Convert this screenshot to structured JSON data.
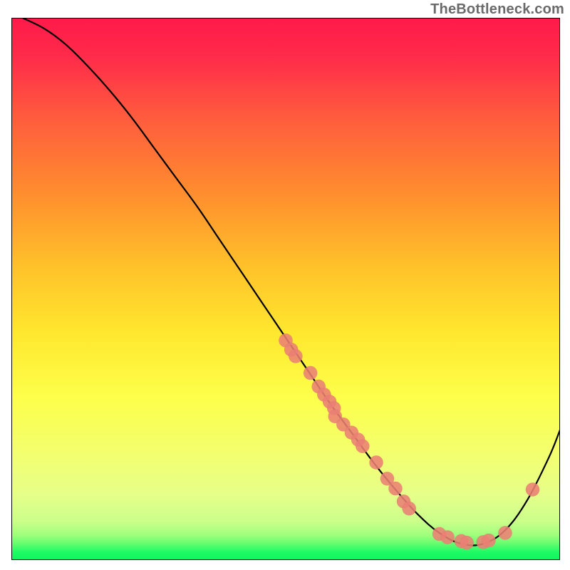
{
  "watermark": {
    "text": "TheBottleneck.com"
  },
  "colors": {
    "gradient_top": "#ff1a4a",
    "gradient_mid_upper": "#ff8c2e",
    "gradient_mid": "#ffe72e",
    "gradient_lower": "#e9ff6b",
    "gradient_green": "#1ffb65",
    "curve_stroke": "#000000",
    "marker_fill": "#eb8074",
    "axis_stroke": "#000000",
    "background": "#ffffff"
  },
  "chart_data": {
    "type": "line",
    "title": "",
    "xlabel": "",
    "ylabel": "",
    "xlim": [
      0,
      100
    ],
    "ylim": [
      0,
      100
    ],
    "curve": {
      "x": [
        2,
        6,
        10,
        14,
        18,
        22,
        26,
        30,
        34,
        38,
        42,
        46,
        50,
        54,
        58,
        62,
        66,
        70,
        74,
        78,
        82,
        86,
        90,
        94,
        98,
        100
      ],
      "y": [
        100,
        98,
        95,
        91,
        86.5,
        81.5,
        76,
        70.5,
        65,
        59,
        53,
        47,
        41,
        35,
        29,
        23.5,
        18,
        13,
        8.5,
        5,
        3,
        3,
        5.5,
        11,
        19,
        24
      ]
    },
    "markers": [
      {
        "x": 50.0,
        "y": 40.5,
        "r": 1.4
      },
      {
        "x": 51.0,
        "y": 38.8,
        "r": 1.4
      },
      {
        "x": 51.8,
        "y": 37.6,
        "r": 1.4
      },
      {
        "x": 54.5,
        "y": 34.5,
        "r": 1.4
      },
      {
        "x": 56.0,
        "y": 32.0,
        "r": 1.4
      },
      {
        "x": 57.0,
        "y": 30.5,
        "r": 1.4
      },
      {
        "x": 58.0,
        "y": 29.2,
        "r": 1.4
      },
      {
        "x": 58.8,
        "y": 28.0,
        "r": 1.4
      },
      {
        "x": 59.0,
        "y": 26.5,
        "r": 1.4
      },
      {
        "x": 60.5,
        "y": 25.0,
        "r": 1.4
      },
      {
        "x": 62.0,
        "y": 23.5,
        "r": 1.4
      },
      {
        "x": 63.2,
        "y": 22.2,
        "r": 1.4
      },
      {
        "x": 64.0,
        "y": 21.0,
        "r": 1.4
      },
      {
        "x": 66.5,
        "y": 18.0,
        "r": 1.4
      },
      {
        "x": 68.5,
        "y": 15.0,
        "r": 1.4
      },
      {
        "x": 70.0,
        "y": 13.2,
        "r": 1.4
      },
      {
        "x": 71.5,
        "y": 10.8,
        "r": 1.4
      },
      {
        "x": 72.5,
        "y": 9.5,
        "r": 1.4
      },
      {
        "x": 78.0,
        "y": 4.8,
        "r": 1.4
      },
      {
        "x": 79.5,
        "y": 4.2,
        "r": 1.4
      },
      {
        "x": 82.0,
        "y": 3.5,
        "r": 1.4
      },
      {
        "x": 83.0,
        "y": 3.2,
        "r": 1.4
      },
      {
        "x": 86.0,
        "y": 3.3,
        "r": 1.4
      },
      {
        "x": 87.0,
        "y": 3.6,
        "r": 1.4
      },
      {
        "x": 90.0,
        "y": 5.0,
        "r": 1.4
      },
      {
        "x": 95.0,
        "y": 13.0,
        "r": 1.4
      }
    ]
  }
}
